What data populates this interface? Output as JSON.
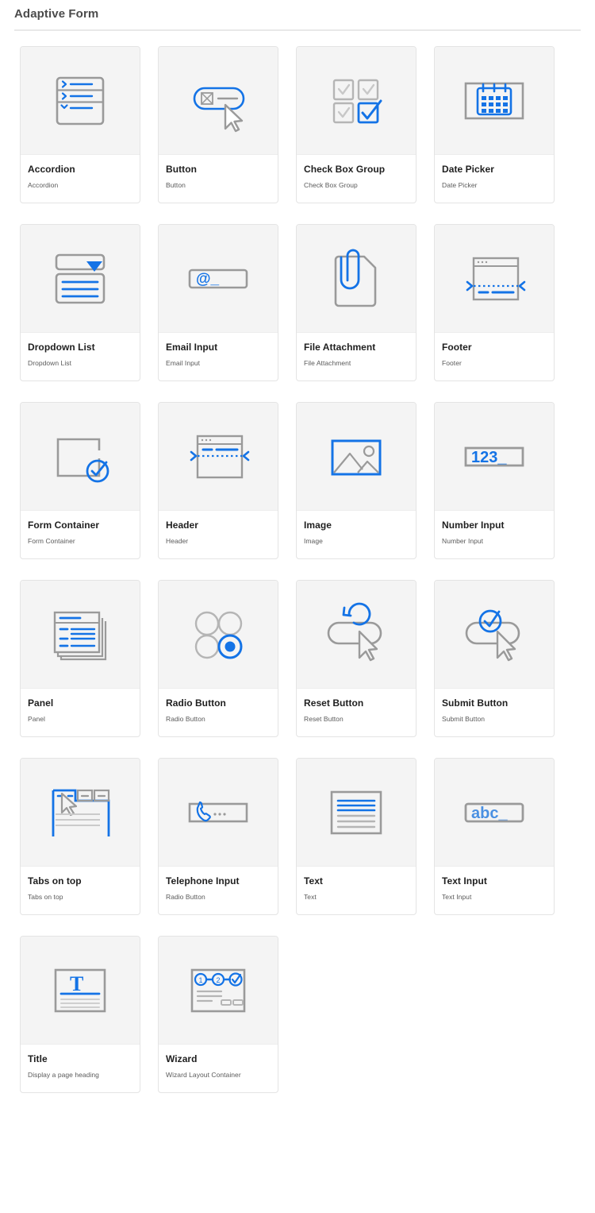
{
  "header": {
    "title": "Adaptive Form"
  },
  "components": [
    {
      "title": "Accordion",
      "subtitle": "Accordion",
      "icon": "accordion-icon"
    },
    {
      "title": "Button",
      "subtitle": "Button",
      "icon": "button-icon"
    },
    {
      "title": "Check Box Group",
      "subtitle": "Check Box Group",
      "icon": "check-box-group-icon"
    },
    {
      "title": "Date Picker",
      "subtitle": "Date Picker",
      "icon": "calendar-icon"
    },
    {
      "title": "Dropdown List",
      "subtitle": "Dropdown List",
      "icon": "dropdown-list-icon"
    },
    {
      "title": "Email Input",
      "subtitle": "Email Input",
      "icon": "email-input-icon"
    },
    {
      "title": "File Attachment",
      "subtitle": "File Attachment",
      "icon": "paperclip-document-icon"
    },
    {
      "title": "Footer",
      "subtitle": "Footer",
      "icon": "footer-icon"
    },
    {
      "title": "Form Container",
      "subtitle": "Form Container",
      "icon": "form-container-icon"
    },
    {
      "title": "Header",
      "subtitle": "Header",
      "icon": "header-icon"
    },
    {
      "title": "Image",
      "subtitle": "Image",
      "icon": "image-icon"
    },
    {
      "title": "Number Input",
      "subtitle": "Number Input",
      "icon": "number-input-icon"
    },
    {
      "title": "Panel",
      "subtitle": "Panel",
      "icon": "panel-stack-icon"
    },
    {
      "title": "Radio Button",
      "subtitle": "Radio Button",
      "icon": "radio-button-icon"
    },
    {
      "title": "Reset Button",
      "subtitle": "Reset Button",
      "icon": "reset-button-icon"
    },
    {
      "title": "Submit Button",
      "subtitle": "Submit Button",
      "icon": "submit-button-icon"
    },
    {
      "title": "Tabs on top",
      "subtitle": "Tabs on top",
      "icon": "tabs-on-top-icon"
    },
    {
      "title": "Telephone Input",
      "subtitle": "Radio Button",
      "icon": "telephone-input-icon"
    },
    {
      "title": "Text",
      "subtitle": "Text",
      "icon": "text-icon"
    },
    {
      "title": "Text Input",
      "subtitle": "Text Input",
      "icon": "text-input-icon"
    },
    {
      "title": "Title",
      "subtitle": "Display a page heading",
      "icon": "title-icon"
    },
    {
      "title": "Wizard",
      "subtitle": "Wizard Layout Container",
      "icon": "wizard-icon"
    }
  ],
  "colors": {
    "accent_blue": "#1473e6",
    "icon_gray": "#9a9a9a",
    "media_background": "#f4f4f4",
    "card_border": "#e4e4e4",
    "title_text": "#1f1f1f",
    "subtitle_text": "#5a5a5a",
    "header_text": "#4b4b4b",
    "rule": "#e8e8e8"
  }
}
